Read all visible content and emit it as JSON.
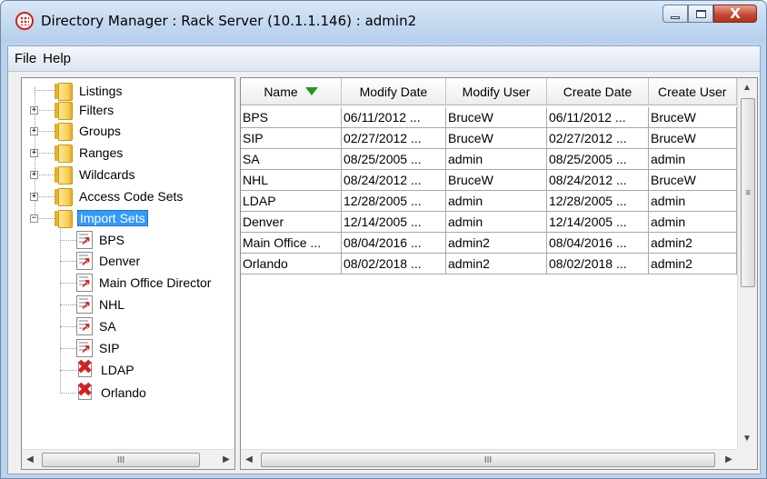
{
  "window": {
    "title": "Directory Manager : Rack Server (10.1.1.146) : admin2",
    "close_glyph": "X"
  },
  "menu": [
    "File",
    "Help"
  ],
  "tree": {
    "folders": [
      "Listings",
      "Filters",
      "Groups",
      "Ranges",
      "Wildcards",
      "Access Code Sets",
      "Import Sets"
    ],
    "import_sets": [
      {
        "label": "BPS",
        "status": "ok"
      },
      {
        "label": "Denver",
        "status": "ok"
      },
      {
        "label": "Main Office Director",
        "status": "ok"
      },
      {
        "label": "NHL",
        "status": "ok"
      },
      {
        "label": "SA",
        "status": "ok"
      },
      {
        "label": "SIP",
        "status": "ok"
      },
      {
        "label": "LDAP",
        "status": "error"
      },
      {
        "label": "Orlando",
        "status": "error"
      }
    ],
    "scroll_glyph": "III"
  },
  "table": {
    "columns": [
      "Name",
      "Modify Date",
      "Modify User",
      "Create Date",
      "Create User"
    ],
    "sort_column": "Name",
    "rows": [
      [
        "BPS",
        "06/11/2012 ...",
        "BruceW",
        "06/11/2012 ...",
        "BruceW"
      ],
      [
        "SIP",
        "02/27/2012 ...",
        "BruceW",
        "02/27/2012 ...",
        "BruceW"
      ],
      [
        "SA",
        "08/25/2005 ...",
        "admin",
        "08/25/2005 ...",
        "admin"
      ],
      [
        "NHL",
        "08/24/2012 ...",
        "BruceW",
        "08/24/2012 ...",
        "BruceW"
      ],
      [
        "LDAP",
        "12/28/2005 ...",
        "admin",
        "12/28/2005 ...",
        "admin"
      ],
      [
        "Denver",
        "12/14/2005 ...",
        "admin",
        "12/14/2005 ...",
        "admin"
      ],
      [
        "Main Office ...",
        "08/04/2016 ...",
        "admin2",
        "08/04/2016 ...",
        "admin2"
      ],
      [
        "Orlando",
        "08/02/2018 ...",
        "admin2",
        "08/02/2018 ...",
        "admin2"
      ]
    ],
    "hscroll_glyph": "III",
    "vscroll_glyph": "≡"
  },
  "colors": {
    "selection": "#3399ff",
    "sort_arrow": "#1f9a1f",
    "error_icon": "#d42020"
  }
}
